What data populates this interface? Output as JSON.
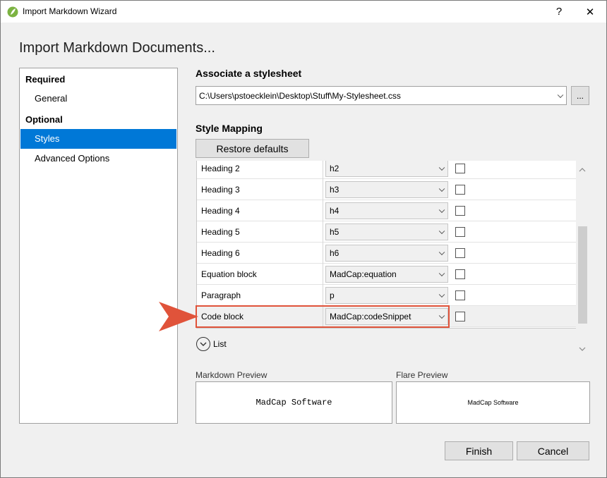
{
  "window": {
    "title": "Import Markdown Wizard",
    "help": "?",
    "close": "✕"
  },
  "page_heading": "Import Markdown Documents...",
  "nav": {
    "groups": [
      {
        "label": "Required",
        "items": [
          "General"
        ]
      },
      {
        "label": "Optional",
        "items": [
          "Styles",
          "Advanced Options"
        ]
      }
    ],
    "selected": "Styles"
  },
  "stylesheet": {
    "title": "Associate a stylesheet",
    "path": "C:\\Users\\pstoecklein\\Desktop\\Stuff\\My-Stylesheet.css",
    "browse_label": "..."
  },
  "style_mapping": {
    "title": "Style Mapping",
    "restore_label": "Restore defaults",
    "rows": [
      {
        "name": "Heading 2",
        "style": "h2",
        "checked": false
      },
      {
        "name": "Heading 3",
        "style": "h3",
        "checked": false
      },
      {
        "name": "Heading 4",
        "style": "h4",
        "checked": false
      },
      {
        "name": "Heading 5",
        "style": "h5",
        "checked": false
      },
      {
        "name": "Heading 6",
        "style": "h6",
        "checked": false
      },
      {
        "name": "Equation block",
        "style": "MadCap:equation",
        "checked": false
      },
      {
        "name": "Paragraph",
        "style": "p",
        "checked": false
      },
      {
        "name": "Code block",
        "style": "MadCap:codeSnippet",
        "checked": false
      }
    ],
    "highlighted_row": "Code block",
    "list_label": "List"
  },
  "previews": {
    "markdown_label": "Markdown Preview",
    "markdown_text": "MadCap Software",
    "flare_label": "Flare Preview",
    "flare_text": "MadCap Software"
  },
  "footer": {
    "finish_label": "Finish",
    "cancel_label": "Cancel"
  },
  "colors": {
    "selection": "#0078d7",
    "callout": "#e0533a"
  }
}
